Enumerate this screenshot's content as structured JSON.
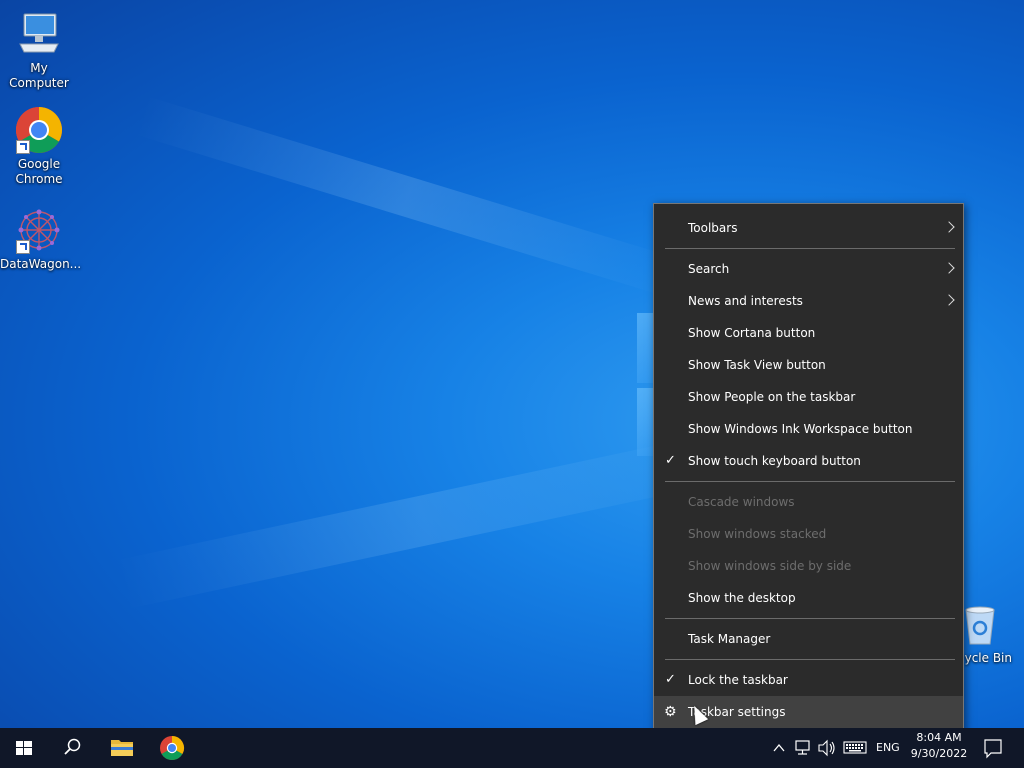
{
  "desktop": {
    "icons": [
      {
        "label": "My Computer"
      },
      {
        "label": "Google Chrome"
      },
      {
        "label": "DataWagon..."
      },
      {
        "label": "ycle Bin"
      }
    ]
  },
  "context_menu": {
    "items": [
      {
        "label": "Toolbars",
        "submenu": true
      },
      {
        "label": "Search",
        "submenu": true
      },
      {
        "label": "News and interests",
        "submenu": true
      },
      {
        "label": "Show Cortana button"
      },
      {
        "label": "Show Task View button"
      },
      {
        "label": "Show People on the taskbar"
      },
      {
        "label": "Show Windows Ink Workspace button"
      },
      {
        "label": "Show touch keyboard button",
        "checked": true
      },
      {
        "label": "Cascade windows",
        "disabled": true
      },
      {
        "label": "Show windows stacked",
        "disabled": true
      },
      {
        "label": "Show windows side by side",
        "disabled": true
      },
      {
        "label": "Show the desktop"
      },
      {
        "label": "Task Manager"
      },
      {
        "label": "Lock the taskbar",
        "checked": true
      },
      {
        "label": "Taskbar settings",
        "icon": "gear-icon",
        "hovered": true
      }
    ],
    "check_glyph": "✓",
    "gear_glyph": "⚙"
  },
  "taskbar": {
    "language": "ENG",
    "time": "8:04 AM",
    "date": "9/30/2022"
  },
  "colors": {
    "menu_bg": "#2b2b2b",
    "menu_hover": "#414141",
    "taskbar_bg": "#101728",
    "desktop_accent": "#0a63cf"
  }
}
